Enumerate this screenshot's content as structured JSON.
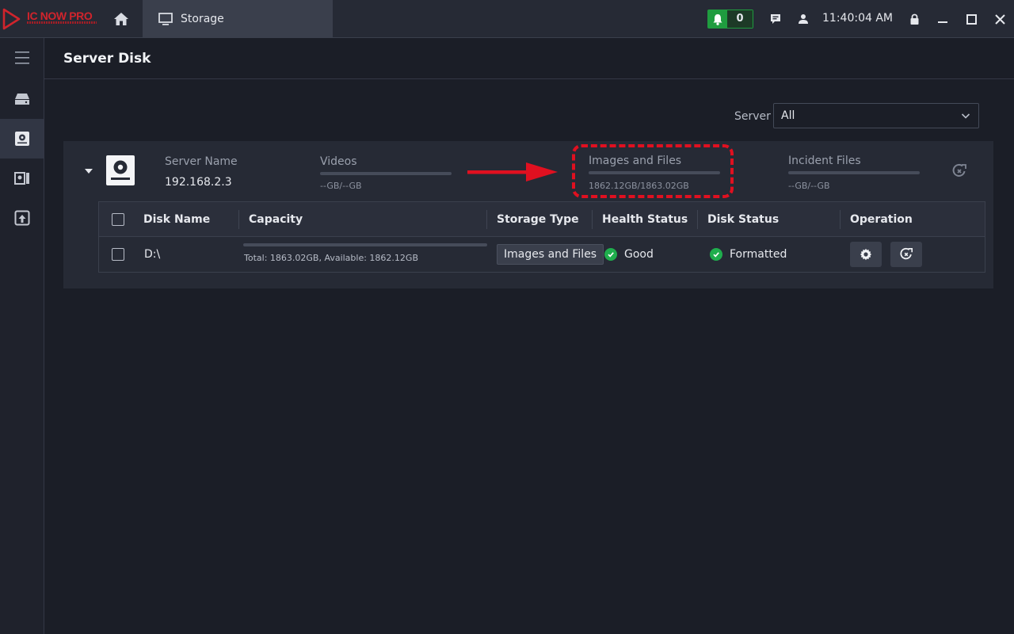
{
  "app": {
    "logo_text": "IC NOW PRO",
    "brand_color": "#d0242c",
    "tab_label": "Storage"
  },
  "topbar": {
    "notification_count": "0",
    "clock": "11:40:04 AM"
  },
  "page": {
    "title": "Server Disk"
  },
  "filter": {
    "label": "Server",
    "selected": "All"
  },
  "server_panel": {
    "server_name_label": "Server Name",
    "server_name": "192.168.2.3",
    "stats": [
      {
        "label": "Videos",
        "value": "--GB/--GB",
        "used_fraction": 0
      },
      {
        "label": "Images and Files",
        "value": "1862.12GB/1863.02GB",
        "used_fraction": 0
      },
      {
        "label": "Incident Files",
        "value": "--GB/--GB",
        "used_fraction": 0
      }
    ]
  },
  "table": {
    "columns": [
      "Disk Name",
      "Capacity",
      "Storage Type",
      "Health Status",
      "Disk Status",
      "Operation"
    ],
    "rows": [
      {
        "disk_name": "D:\\",
        "capacity_text": "Total: 1863.02GB,  Available: 1862.12GB",
        "storage_type": "Images and Files",
        "health_status": "Good",
        "disk_status": "Formatted"
      }
    ]
  },
  "icons": {
    "home": "home-icon",
    "monitor": "monitor-icon",
    "bell": "bell-icon",
    "message": "message-icon",
    "user": "user-icon",
    "lock": "lock-icon",
    "minimize": "minimize-icon",
    "maximize": "maximize-icon",
    "close": "close-icon",
    "gear": "gear-icon",
    "disk": "disk-icon"
  },
  "colors": {
    "accent_green": "#1fae4d",
    "highlight_red": "#e01020"
  }
}
